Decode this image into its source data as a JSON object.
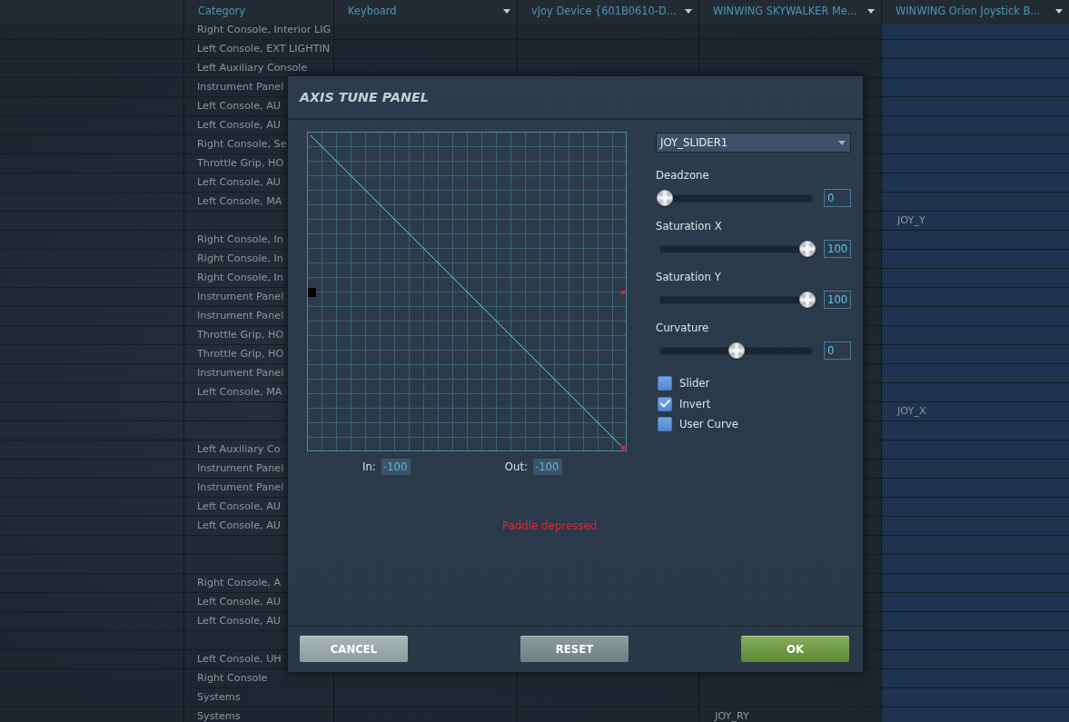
{
  "table": {
    "columns": [
      {
        "label": "Category",
        "dropdown": false,
        "selected": false
      },
      {
        "label": "Keyboard",
        "dropdown": true,
        "selected": false
      },
      {
        "label": "vJoy Device {601B0610-D...",
        "dropdown": true,
        "selected": false
      },
      {
        "label": "WINWING SKYWALKER Me...",
        "dropdown": true,
        "selected": false
      },
      {
        "label": "WINWING Orion Joystick B...",
        "dropdown": true,
        "selected": true
      }
    ],
    "rows": [
      {
        "category": "Right Console, Interior LIG"
      },
      {
        "category": "Left Console, EXT LIGHTIN"
      },
      {
        "category": "Left Auxiliary Console"
      },
      {
        "category": "Instrument Panel"
      },
      {
        "category": "Left Console, AU"
      },
      {
        "category": "Left Console, AU"
      },
      {
        "category": "Right Console, Se"
      },
      {
        "category": "Throttle Grip, HO"
      },
      {
        "category": "Left Console, AU"
      },
      {
        "category": "Left Console, MA"
      },
      {
        "winwing_orion": "JOY_Y"
      },
      {
        "category": "Right Console, In"
      },
      {
        "category": "Right Console, In"
      },
      {
        "category": "Right Console, In"
      },
      {
        "category": "Instrument Panel"
      },
      {
        "category": "Instrument Panel"
      },
      {
        "category": "Throttle Grip, HO"
      },
      {
        "category": "Throttle Grip, HO"
      },
      {
        "category": "Instrument Panel"
      },
      {
        "category": "Left Console, MA"
      },
      {
        "winwing_orion": "JOY_X"
      },
      {},
      {
        "category": "Left Auxiliary Co"
      },
      {
        "category": "Instrument Panel"
      },
      {
        "category": "Instrument Panel"
      },
      {
        "category": "Left Console, AU"
      },
      {
        "category": "Left Console, AU"
      },
      {},
      {},
      {
        "category": "Right Console, A"
      },
      {
        "category": "Left Console, AU"
      },
      {
        "category": "Left Console, AU"
      },
      {},
      {
        "category": "Left Console, UH"
      },
      {
        "category": "Right Console"
      },
      {
        "category": "Systems"
      },
      {
        "category": "Systems",
        "winwing_skywalker": "JOY_RY"
      }
    ]
  },
  "dialog": {
    "title": "AXIS TUNE PANEL",
    "axis": "JOY_SLIDER1",
    "in_label": "In:",
    "in_value": "-100",
    "out_label": "Out:",
    "out_value": "-100",
    "status": "Paddle depressed",
    "sliders": [
      {
        "label": "Deadzone",
        "level": 0,
        "value": "0"
      },
      {
        "label": "Saturation X",
        "level": 1,
        "value": "100"
      },
      {
        "label": "Saturation Y",
        "level": 1,
        "value": "100"
      },
      {
        "label": "Curvature",
        "level": 0.5,
        "value": "0"
      }
    ],
    "options": [
      {
        "label": "Slider",
        "checked": false
      },
      {
        "label": "Invert",
        "checked": true
      },
      {
        "label": "User Curve",
        "checked": false
      }
    ],
    "buttons": [
      {
        "label": "CANCEL",
        "kind": "cancel"
      },
      {
        "label": "RESET",
        "kind": "reset"
      },
      {
        "label": "OK",
        "kind": "ok"
      }
    ]
  }
}
